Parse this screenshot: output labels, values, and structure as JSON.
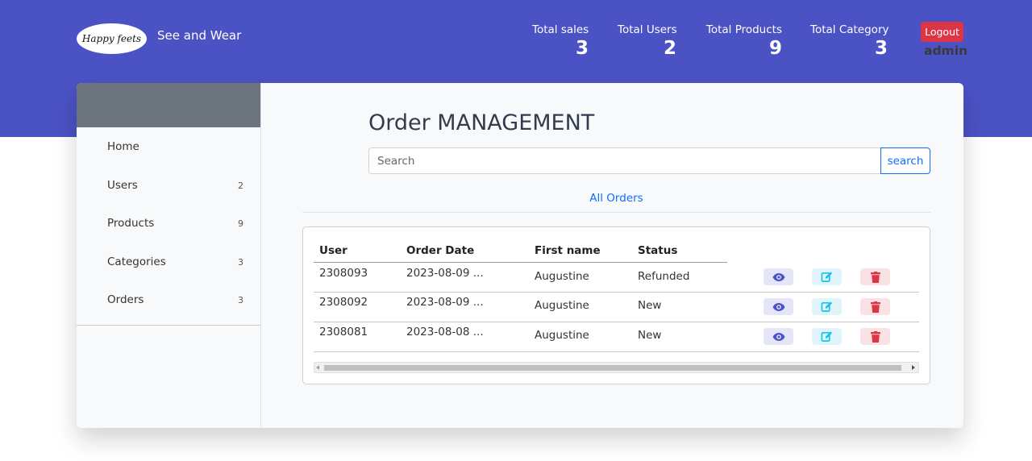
{
  "header": {
    "logo_text": "Happy feets",
    "brand": "See and Wear",
    "stats": [
      {
        "label": "Total sales",
        "value": "3"
      },
      {
        "label": "Total Users",
        "value": "2"
      },
      {
        "label": "Total Products",
        "value": "9"
      },
      {
        "label": "Total Category",
        "value": "3"
      }
    ],
    "logout_label": "Logout",
    "admin_name": "admin"
  },
  "sidebar": {
    "items": [
      {
        "label": "Home",
        "count": ""
      },
      {
        "label": "Users",
        "count": "2"
      },
      {
        "label": "Products",
        "count": "9"
      },
      {
        "label": "Categories",
        "count": "3"
      },
      {
        "label": "Orders",
        "count": "3"
      }
    ]
  },
  "main": {
    "title": "Order MANAGEMENT",
    "search_placeholder": "Search",
    "search_button": "search",
    "filter_link": "All Orders",
    "table": {
      "headers": [
        "User",
        "Order Date",
        "First name",
        "Status"
      ],
      "rows": [
        {
          "user": "2308093",
          "date": "2023-08-09 ...",
          "first_name": "Augustine",
          "status": "Refunded"
        },
        {
          "user": "2308092",
          "date": "2023-08-09 ...",
          "first_name": "Augustine",
          "status": "New"
        },
        {
          "user": "2308081",
          "date": "2023-08-08 ...",
          "first_name": "Augustine",
          "status": "New"
        }
      ]
    }
  },
  "icons": {
    "view": "eye-icon",
    "edit": "edit-icon",
    "delete": "trash-icon"
  },
  "colors": {
    "header_bg": "#4b52c4",
    "logout_bg": "#dc3545",
    "link": "#0d6efd",
    "view_icon": "#4b52c4",
    "edit_icon": "#17c1e8",
    "delete_icon": "#dc3545"
  }
}
